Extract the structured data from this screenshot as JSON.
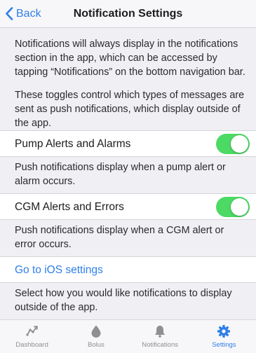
{
  "nav": {
    "back_label": "Back",
    "title": "Notification Settings"
  },
  "intro": {
    "para1": "Notifications will always display in the notifications section in the app, which can be accessed by tapping “Notifications” on the bottom navigation bar.",
    "para2": "These toggles control which types of messages are sent as push notifications, which display outside of the app."
  },
  "settings": [
    {
      "label": "Pump Alerts and Alarms",
      "enabled": true,
      "note": "Push notifications display when a pump alert or alarm occurs."
    },
    {
      "label": "CGM Alerts and Errors",
      "enabled": true,
      "note": "Push notifications display when a CGM alert or error occurs."
    }
  ],
  "ios_link": {
    "label": "Go to iOS settings",
    "note": "Select how you would like notifications to display outside of the app."
  },
  "tabs": [
    {
      "label": "Dashboard",
      "icon": "trend-icon",
      "active": false
    },
    {
      "label": "Bolus",
      "icon": "drop-icon",
      "active": false
    },
    {
      "label": "Notifications",
      "icon": "bell-icon",
      "active": false
    },
    {
      "label": "Settings",
      "icon": "gear-icon",
      "active": true
    }
  ],
  "colors": {
    "accent": "#2f7fe8",
    "toggle_on": "#4cd964",
    "inactive": "#8e8e93",
    "background": "#efeff4"
  }
}
